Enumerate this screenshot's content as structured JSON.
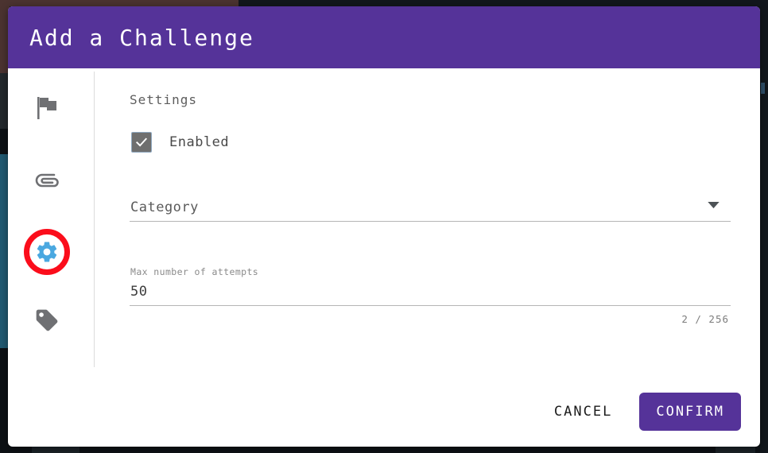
{
  "window": {
    "title": "Add a Challenge",
    "accent_purple": "#553399",
    "annotation_red": "#fb0d1b",
    "gear_blue": "#4aa8e0"
  },
  "sidebar": {
    "items": [
      {
        "icon": "flag-icon",
        "active": false
      },
      {
        "icon": "paperclip-icon",
        "active": false
      },
      {
        "icon": "gear-icon",
        "active": true
      },
      {
        "icon": "tag-icon",
        "active": false
      }
    ]
  },
  "form": {
    "heading": "Settings",
    "enabled": {
      "label": "Enabled",
      "checked": true,
      "check_glyph": "✔"
    },
    "category": {
      "label": "Category",
      "value": "Category",
      "caret_icon": "chevron-down-icon",
      "options": []
    },
    "attempts": {
      "label": "Max number of attempts",
      "value": "50",
      "counter": "2 / 256"
    }
  },
  "footer": {
    "cancel_label": "CANCEL",
    "confirm_label": "CONFIRM"
  }
}
